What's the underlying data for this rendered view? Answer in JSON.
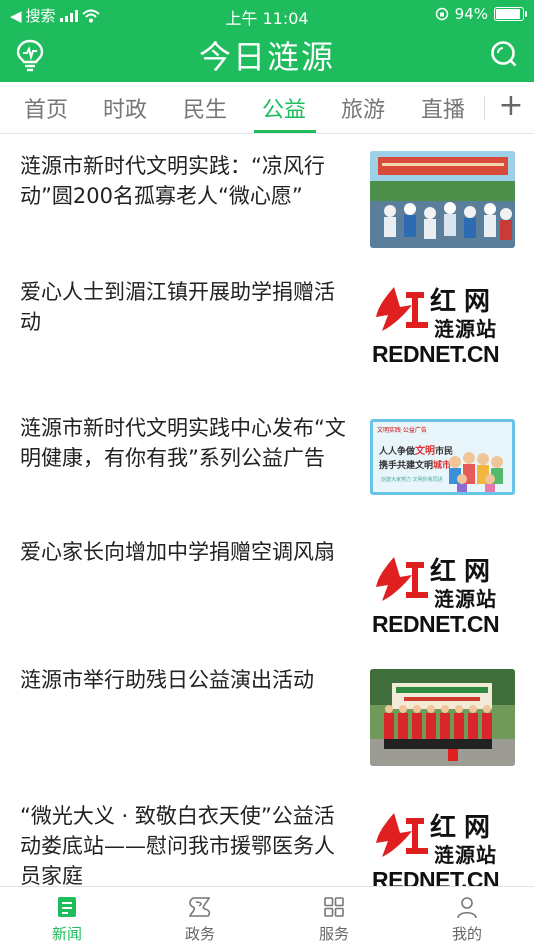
{
  "status": {
    "carrier": "搜索",
    "time": "上午 11:04",
    "battery": "94%"
  },
  "header": {
    "title": "今日涟源"
  },
  "tabs": [
    {
      "label": "首页",
      "active": false
    },
    {
      "label": "时政",
      "active": false
    },
    {
      "label": "民生",
      "active": false
    },
    {
      "label": "公益",
      "active": true
    },
    {
      "label": "旅游",
      "active": false
    },
    {
      "label": "直播",
      "active": false
    }
  ],
  "news": [
    {
      "title": "涟源市新时代文明实践：“凉风行动”圆200名孤寡老人“微心愿”",
      "thumb": "photo-crowd"
    },
    {
      "title": "爱心人士到湄江镇开展助学捐赠活动",
      "thumb": "rednet-logo"
    },
    {
      "title": "涟源市新时代文明实践中心发布“文明健康，有你有我”系列公益广告",
      "thumb": "poster"
    },
    {
      "title": "爱心家长向增加中学捐赠空调风扇",
      "thumb": "rednet-logo"
    },
    {
      "title": "涟源市举行助残日公益演出活动",
      "thumb": "photo-performers"
    },
    {
      "title": "“微光大义 · 致敬白衣天使”公益活动娄底站——慰问我市援鄂医务人员家庭",
      "thumb": "rednet-logo"
    }
  ],
  "rednet": {
    "name": "红网",
    "sub": "涟源站",
    "domain": "REDNET.CN"
  },
  "poster": {
    "header": "文明实践 公益广告",
    "line1_a": "人人争做",
    "line1_b": "文明",
    "line1_c": "市民",
    "line2_a": "携手共建文明",
    "line2_b": "城市",
    "line3": "创建大家努力 文明你我同进"
  },
  "bottom_nav": [
    {
      "label": "新闻",
      "icon": "news-icon",
      "active": true
    },
    {
      "label": "政务",
      "icon": "government-icon",
      "active": false
    },
    {
      "label": "服务",
      "icon": "grid-icon",
      "active": false
    },
    {
      "label": "我的",
      "icon": "person-icon",
      "active": false
    }
  ],
  "colors": {
    "brand": "#1ebc5c",
    "text": "#222222",
    "muted": "#777777"
  }
}
